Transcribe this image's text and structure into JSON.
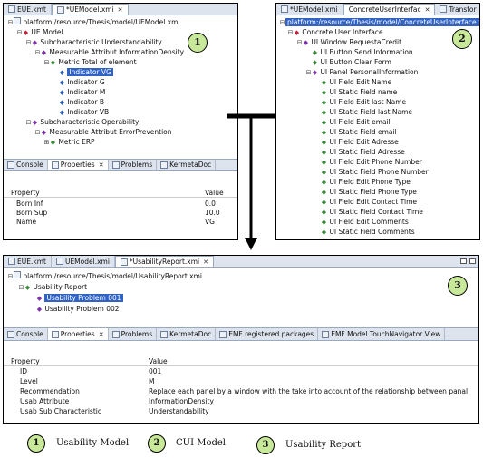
{
  "usability_model": {
    "tabs": [
      {
        "label": "EUE.kmt",
        "active": false
      },
      {
        "label": "*UEModel.xmi",
        "active": true
      }
    ],
    "tree": [
      {
        "label": "platform:/resource/Thesis/model/UEModel.xmi",
        "marker": "",
        "style": "plain"
      },
      {
        "label": "UE Model",
        "marker": "◆",
        "style": "red"
      },
      {
        "label": "Subcharacteristic Understandability",
        "marker": "◆",
        "style": "purple"
      },
      {
        "label": "Measurable Attribut InformationDensity",
        "marker": "◆",
        "style": "purple"
      },
      {
        "label": "Metric Total of element",
        "marker": "◆",
        "style": "green"
      },
      {
        "label": "Indicator VG",
        "marker": "◆",
        "style": "selected"
      },
      {
        "label": "Indicator G",
        "marker": "◆",
        "style": "blue"
      },
      {
        "label": "Indicator M",
        "marker": "◆",
        "style": "blue"
      },
      {
        "label": "Indicator B",
        "marker": "◆",
        "style": "blue"
      },
      {
        "label": "Indicator VB",
        "marker": "◆",
        "style": "blue"
      },
      {
        "label": "Subcharacteristic Operability",
        "marker": "◆",
        "style": "purple"
      },
      {
        "label": "Measurable Attribut ErrorPrevention",
        "marker": "◆",
        "style": "purple"
      },
      {
        "label": "Metric ERP",
        "marker": "◆",
        "style": "green"
      }
    ],
    "view_tabs": [
      "Console",
      "Properties",
      "Problems",
      "KermetaDoc"
    ],
    "properties_header": {
      "key": "Property",
      "value": "Value"
    },
    "properties": [
      {
        "key": "Born Inf",
        "value": "0.0"
      },
      {
        "key": "Born Sup",
        "value": "10.0"
      },
      {
        "key": "Name",
        "value": "VG"
      }
    ],
    "badge": "1"
  },
  "cui_model": {
    "tabs": [
      {
        "label": "*UEModel.xmi",
        "active": false
      },
      {
        "label": "ConcreteUserInterfac",
        "active": true
      },
      {
        "label": "Transfor",
        "active": false
      }
    ],
    "tree": [
      {
        "label": "platform:/resource/Thesis/model/ConcreteUserInterface.xmi",
        "style": "selected"
      },
      {
        "label": "Concrete User Interface",
        "style": "red"
      },
      {
        "label": "UI Window RequestaCredit",
        "style": "purple"
      },
      {
        "label": "UI Button Send Information",
        "style": "green"
      },
      {
        "label": "UI Button Clear Form",
        "style": "green"
      },
      {
        "label": "UI Panel PersonalInformation",
        "style": "purple"
      },
      {
        "label": "UI Field Edit Name",
        "style": "green"
      },
      {
        "label": "UI Static Field name",
        "style": "green"
      },
      {
        "label": "UI Field Edit last Name",
        "style": "green"
      },
      {
        "label": "UI Static Field last Name",
        "style": "green"
      },
      {
        "label": "UI Field Edit email",
        "style": "green"
      },
      {
        "label": "UI Static Field email",
        "style": "green"
      },
      {
        "label": "UI Field Edit Adresse",
        "style": "green"
      },
      {
        "label": "UI Static Field Adresse",
        "style": "green"
      },
      {
        "label": "UI Field Edit Phone Number",
        "style": "green"
      },
      {
        "label": "UI Static Field Phone Number",
        "style": "green"
      },
      {
        "label": "UI Field Edit Phone Type",
        "style": "green"
      },
      {
        "label": "UI Static Field Phone Type",
        "style": "green"
      },
      {
        "label": "UI Field Edit Contact Time",
        "style": "green"
      },
      {
        "label": "UI Static Field Contact Time",
        "style": "green"
      },
      {
        "label": "UI Field Edit Comments",
        "style": "green"
      },
      {
        "label": "UI Static Field Comments",
        "style": "green"
      }
    ],
    "badge": "2"
  },
  "usability_report": {
    "tabs": [
      {
        "label": "EUE.kmt",
        "active": false
      },
      {
        "label": "UEModel.xmi",
        "active": false
      },
      {
        "label": "*UsabilityReport.xmi",
        "active": true
      }
    ],
    "tree": [
      {
        "label": "platform:/resource/Thesis/model/UsabilityReport.xmi",
        "style": "plain"
      },
      {
        "label": "Usability Report",
        "style": "green"
      },
      {
        "label": "Usability Problem 001",
        "style": "selected"
      },
      {
        "label": "Usability Problem 002",
        "style": "purple"
      }
    ],
    "view_tabs": [
      "Console",
      "Properties",
      "Problems",
      "KermetaDoc",
      "EMF registered packages",
      "EMF Model TouchNavigator View"
    ],
    "properties_header": {
      "key": "Property",
      "value": "Value"
    },
    "properties": [
      {
        "key": "ID",
        "value": "001"
      },
      {
        "key": "Level",
        "value": "M"
      },
      {
        "key": "Recommendation",
        "value": "Replace each panel by a window with the take into account of the relationship between panal"
      },
      {
        "key": "Usab Attribute",
        "value": "InformationDensity"
      },
      {
        "key": "Usab Sub Characteristic",
        "value": "Understandability"
      }
    ],
    "badge": "3"
  },
  "legend": [
    {
      "number": "1",
      "label": "Usability Model"
    },
    {
      "number": "2",
      "label": "CUI Model"
    },
    {
      "number": "3",
      "label": "Usability Report"
    }
  ],
  "colors": {
    "selection": "#3163c6",
    "badge": "#c8e89a",
    "tab_bar": "#dde4ee"
  }
}
